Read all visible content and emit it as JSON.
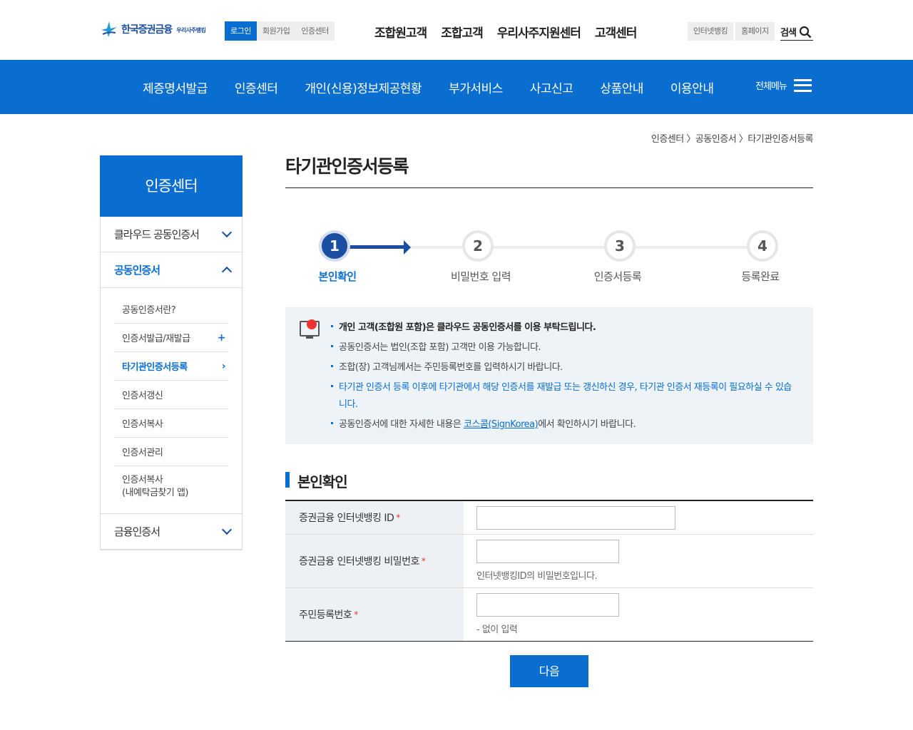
{
  "header": {
    "logo_text": "한국증권금융",
    "logo_sub": "우리사주뱅킹",
    "util": [
      "로그인",
      "회원가입",
      "인증센터"
    ],
    "gnb": [
      "조합원고객",
      "조합고객",
      "우리사주지원센터",
      "고객센터"
    ],
    "right_buttons": [
      "인터넷뱅킹",
      "홈페이지"
    ],
    "search_label": "검색"
  },
  "nav": {
    "items": [
      "제증명서발급",
      "인증센터",
      "개인(신용)정보제공현황",
      "부가서비스",
      "사고신고",
      "상품안내",
      "이용안내"
    ],
    "all_menu": "전체메뉴"
  },
  "breadcrumb": "인증센터 〉공동인증서 〉타기관인증서등록",
  "sidebar": {
    "title": "인증센터",
    "items": [
      {
        "label": "클라우드 공동인증서"
      },
      {
        "label": "공동인증서"
      },
      {
        "label": "금융인증서"
      }
    ],
    "sub_items": [
      {
        "label": "공동인증서란?"
      },
      {
        "label": "인증서발급/재발급",
        "mark": "+"
      },
      {
        "label": "타기관인증서등록",
        "mark": "›"
      },
      {
        "label": "인증서갱신"
      },
      {
        "label": "인증서복사"
      },
      {
        "label": "인증서관리"
      },
      {
        "label": "인증서복사",
        "label2": "(내예탁금찾기 앱)"
      }
    ]
  },
  "main": {
    "title": "타기관인증서등록",
    "steps": [
      {
        "num": "1",
        "label": "본인확인"
      },
      {
        "num": "2",
        "label": "비밀번호 입력"
      },
      {
        "num": "3",
        "label": "인증서등록"
      },
      {
        "num": "4",
        "label": "등록완료"
      }
    ],
    "notice": {
      "n1": "개인 고객(조합원 포함)은 클라우드 공동인증서를 이용 부탁드립니다.",
      "n2": "공동인증서는 법인(조합 포함) 고객만 이용 가능합니다.",
      "n3": "조합(장) 고객님께서는 주민등록번호를 입력하시기 바랍니다.",
      "n4": "타기관 인증서 등록 이후에 타기관에서 해당 인증서를 재발급 또는 갱신하신 경우, 타기관 인증서 재등록이 필요하실 수 있습니다.",
      "n5_pre": "공동인증서에 대한 자세한 내용은 ",
      "n5_link": "코스콤(SignKorea)",
      "n5_post": "에서 확인하시기 바랍니다."
    },
    "section_title": "본인확인",
    "form": {
      "id_label": "증권금융 인터넷뱅킹 ID",
      "pw_label": "증권금융 인터넷뱅킹 비밀번호",
      "pw_hint": "인터넷뱅킹ID의 비밀번호입니다.",
      "rrn_label": "주민등록번호",
      "rrn_hint": "- 없이 입력",
      "required": "*"
    },
    "next_button": "다음"
  }
}
